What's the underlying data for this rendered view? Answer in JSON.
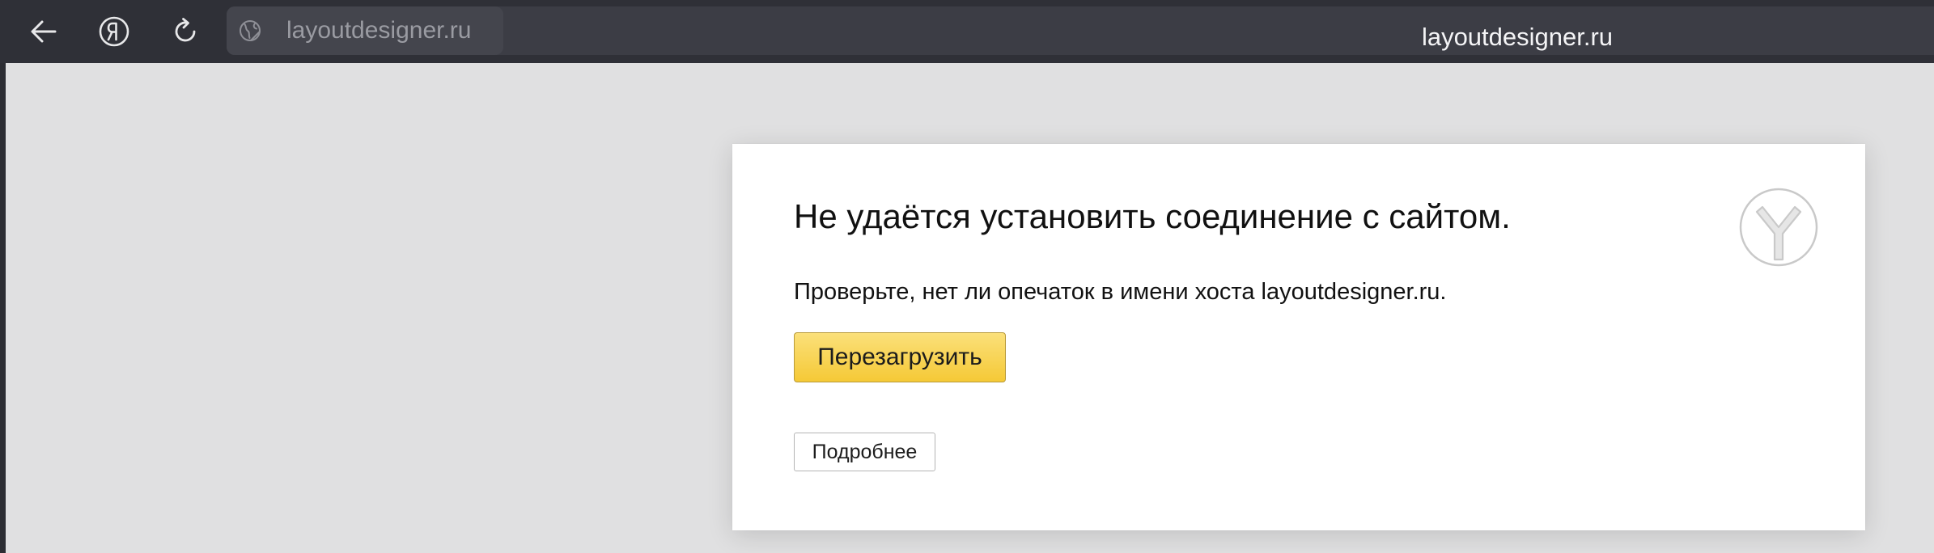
{
  "toolbar": {
    "back_icon": "arrow-left-icon",
    "yandex_icon": "yandex-ya-icon",
    "reload_icon": "reload-icon"
  },
  "omnibox": {
    "chip_domain": "layoutdesigner.ru",
    "center_domain": "layoutdesigner.ru",
    "globe_icon": "globe-icon"
  },
  "error_page": {
    "title": "Не удаётся установить соединение с сайтом.",
    "description": "Проверьте, нет ли опечаток в имени хоста layoutdesigner.ru.",
    "reload_button": "Перезагрузить",
    "details_button": "Подробнее",
    "logo_icon": "yandex-browser-logo-icon"
  },
  "colors": {
    "toolbar_bg": "#2f3037",
    "content_bg": "#e0e0e1",
    "reload_button_bg": "#f7d354"
  }
}
